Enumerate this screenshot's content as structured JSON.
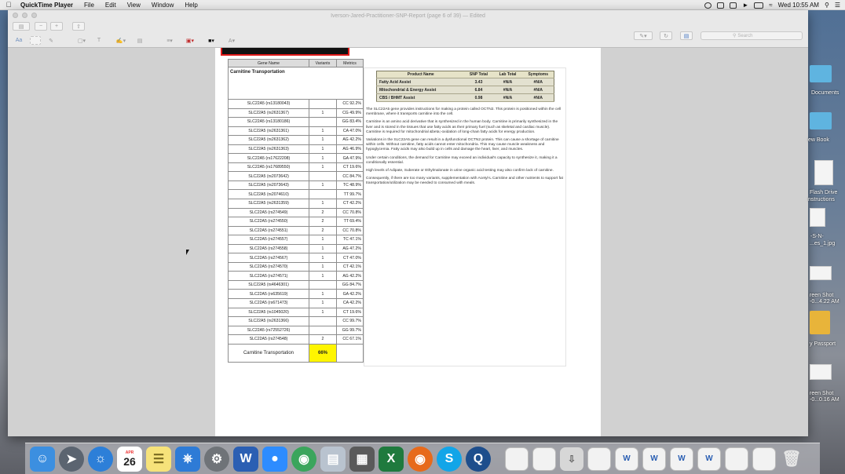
{
  "menubar": {
    "app_name": "QuickTime Player",
    "menus": [
      "File",
      "Edit",
      "View",
      "Window",
      "Help"
    ],
    "clock": "Wed 10:55 AM"
  },
  "window": {
    "title": "Iverson-Jared-Practitioner-SNP-Report (page 6 of 39) — Edited",
    "search_placeholder": "Search"
  },
  "gene_table": {
    "headers": [
      "Gene Name",
      "Variants",
      "Metrics"
    ],
    "section_title": "Carnitine Transportation",
    "rows": [
      [
        "SLC22A5 (rs13180043)",
        "",
        "CC 92.2%"
      ],
      [
        "SLC22A5 (rs2631367)",
        "1",
        "CG 49.9%"
      ],
      [
        "SLC22A5 (rs13180186)",
        "",
        "GG 83.4%"
      ],
      [
        "SLC22A5 (rs2631361)",
        "1",
        "CA 47.0%"
      ],
      [
        "SLC22A5 (rs2631362)",
        "1",
        "AG 42.2%"
      ],
      [
        "SLC22A5 (rs2631363)",
        "1",
        "AG 46.9%"
      ],
      [
        "SLC22A5 (rs17622208)",
        "1",
        "GA 47.9%"
      ],
      [
        "SLC22A5 (rs17689550)",
        "1",
        "CT 19.6%"
      ],
      [
        "SLC22A5 (rs2073642)",
        "",
        "CC 84.7%"
      ],
      [
        "SLC22A5 (rs2073643)",
        "1",
        "TC 48.9%"
      ],
      [
        "SLC22A5 (rs2074610)",
        "",
        "TT 99.7%"
      ],
      [
        "SLC22A5 (rs2631359)",
        "1",
        "CT 42.2%"
      ],
      [
        "SLC22A5 (rs274549)",
        "2",
        "CC 70.8%"
      ],
      [
        "SLC22A5 (rs274550)",
        "2",
        "TT 69.4%"
      ],
      [
        "SLC22A5 (rs274551)",
        "2",
        "CC 70.8%"
      ],
      [
        "SLC22A5 (rs274557)",
        "1",
        "TC 47.1%"
      ],
      [
        "SLC22A5 (rs274558)",
        "1",
        "AG 47.2%"
      ],
      [
        "SLC22A5 (rs274567)",
        "1",
        "CT 47.0%"
      ],
      [
        "SLC22A5 (rs274570)",
        "1",
        "CT 42.1%"
      ],
      [
        "SLC22A5 (rs274571)",
        "1",
        "AG 42.2%"
      ],
      [
        "SLC22A5 (rs4646301)",
        "",
        "GG 84.7%"
      ],
      [
        "SLC22A5 (rs635619)",
        "1",
        "GA 42.2%"
      ],
      [
        "SLC22A5 (rs671473)",
        "1",
        "CA 42.2%"
      ],
      [
        "SLC22A5 (rs1045020)",
        "1",
        "CT 19.6%"
      ],
      [
        "SLC22A5 (rs2631366)",
        "",
        "CC 99.7%"
      ],
      [
        "SLC22A5 (rs72552726)",
        "",
        "GG 99.7%"
      ],
      [
        "SLC22A5 (rs274548)",
        "2",
        "CC 67.1%"
      ]
    ],
    "total_label": "Carnitine Transportation",
    "total_value": "66%"
  },
  "product_table": {
    "headers": [
      "Product Name",
      "SNP Total",
      "Lab Total",
      "Symptoms"
    ],
    "rows": [
      [
        "Fatty Acid Assist",
        "3.43",
        "#N/A",
        "#N/A"
      ],
      [
        "Mitochondrial & Energy Assist",
        "6.84",
        "#N/A",
        "#N/A"
      ],
      [
        "CBS / BHMT Assist",
        "0.98",
        "#N/A",
        "#N/A"
      ]
    ]
  },
  "paragraphs": [
    "The SLC22A5 gene provides instructions for making a protein called OCTN2. This protein is positioned within the cell membrane, where it transports carnitine into the cell.",
    "Carnitine is an amino acid derivative that is synthesized in the human body. Carnitine is primarily synthesized in the liver and is stored in the tissues that use fatty acids as their primary fuel (such as skeletal and cardiac muscle). Carnitine is required for mitochondrial &beta;-oxidation of long-chain fatty acids for energy production.",
    "Variations in the SLC22A5 gene can result in a dysfunctional OCTN2 protein. This can cause a shortage of carnitine within cells. Without carnitine, fatty acids cannot enter mitochondria. This may cause muscle weakness and hypoglycemia. Fatty acids may also build up in cells and damage the heart, liver, and muscles.",
    "Under certain conditions, the demand for Carnitine may exceed an individual's capacity to synthesize it, making it a conditionally essential.",
    "High levels of Adipate, Suberate or Ethylmalonate in urine organic acid testing may also confirm lack of carnitine.",
    "Consequently, if there are too many variants, supplementation with Acetyl-L Carnitine and other nutrients to support fat transportation/utilization may be needed to consumed with meals."
  ],
  "desktop": {
    "items": [
      "Documents",
      "ew Book",
      "Flash Drive",
      "nstructions",
      "-S-N-",
      "...es_1.jpg",
      "reen Shot",
      "-0...4.22 AM",
      "y Passport",
      "reen Shot",
      "-0...0.16 AM"
    ]
  },
  "dock": {
    "calendar_month": "APR",
    "calendar_day": "26"
  }
}
